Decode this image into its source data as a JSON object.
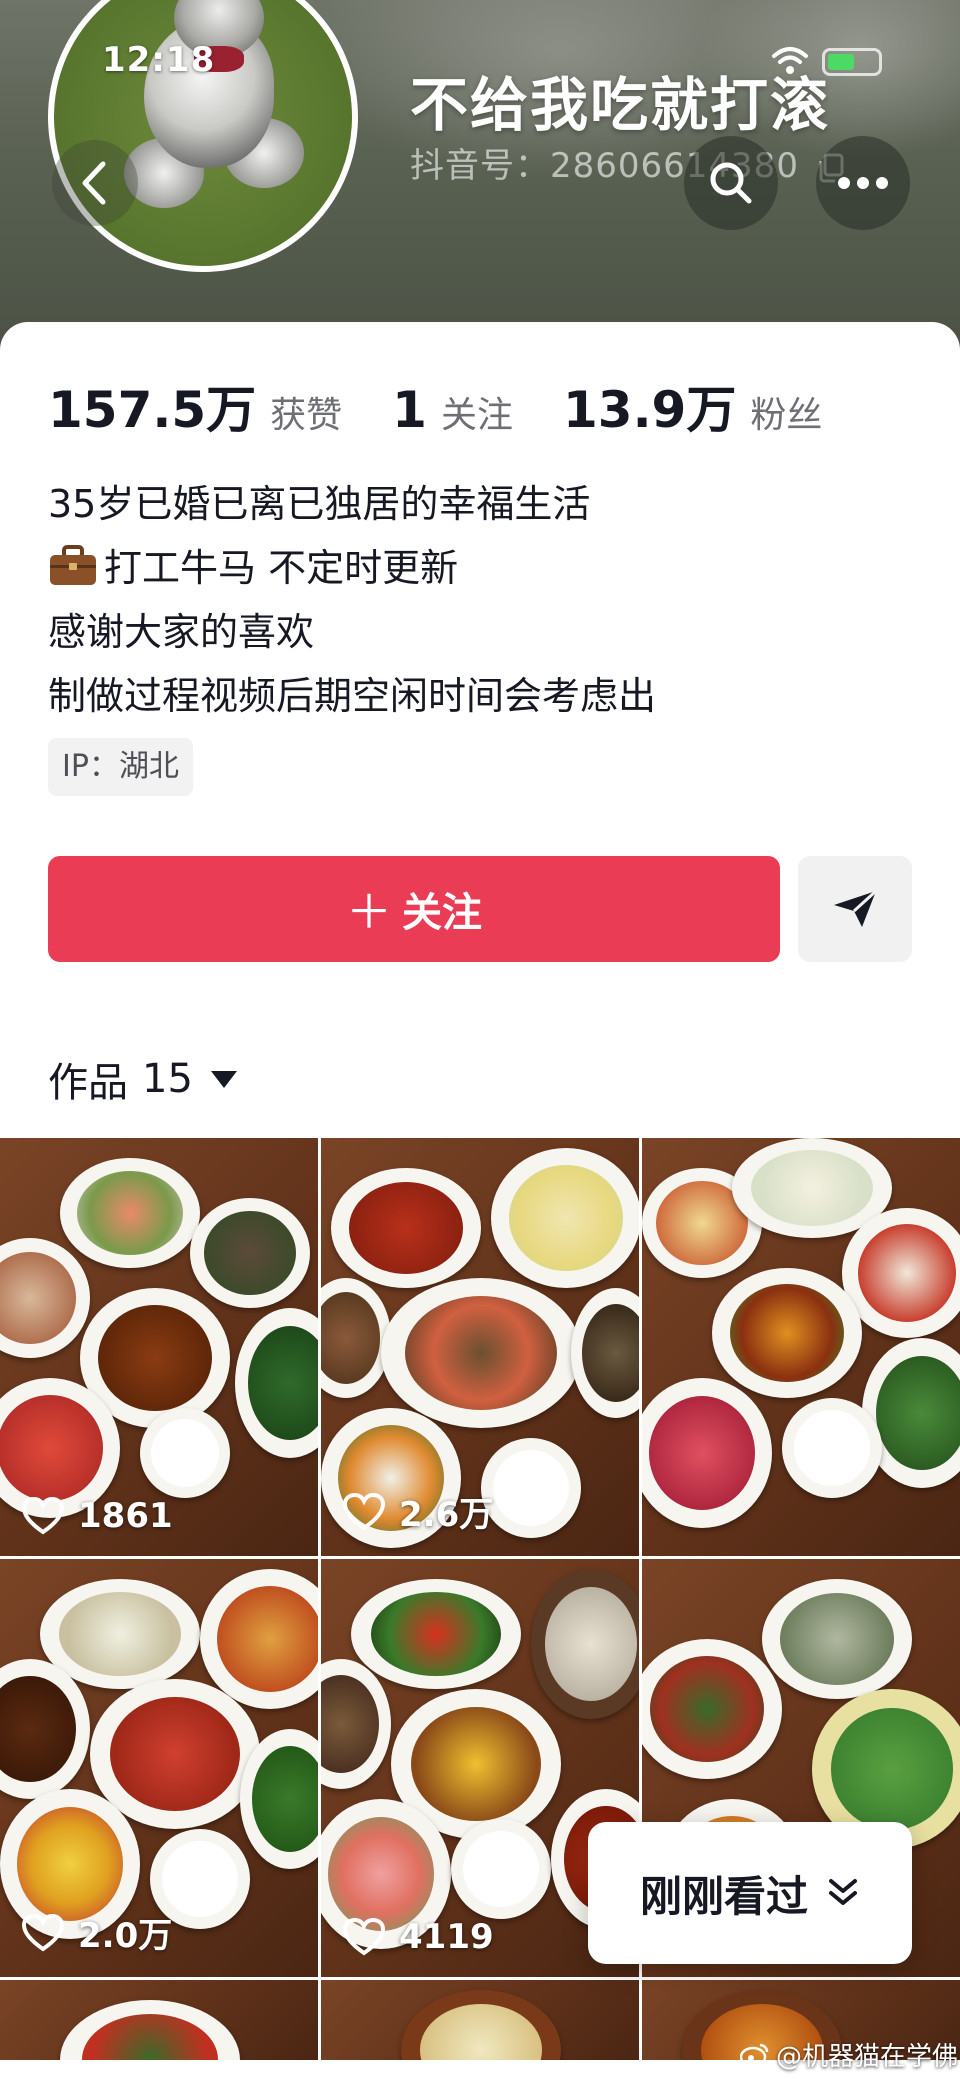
{
  "status_bar": {
    "time": "12:18"
  },
  "profile": {
    "username": "不给我吃就打滚",
    "douyin_id": "抖音号：28606614380",
    "stats": [
      {
        "value": "157.5万",
        "label": "获赞"
      },
      {
        "value": "1",
        "label": "关注"
      },
      {
        "value": "13.9万",
        "label": "粉丝"
      }
    ],
    "bio": [
      "35岁已婚已离已独居的幸福生活",
      "打工牛马 不定时更新",
      "感谢大家的喜欢",
      "制做过程视频后期空闲时间会考虑出"
    ],
    "ip": "IP：湖北"
  },
  "actions": {
    "follow_label": "关注"
  },
  "works": {
    "title": "作品",
    "count": "15",
    "tiles": [
      {
        "likes": "1861"
      },
      {
        "likes": "2.6万"
      },
      {
        "likes": ""
      },
      {
        "likes": "2.0万"
      },
      {
        "likes": "4119"
      },
      {
        "likes": ""
      }
    ]
  },
  "recent_button": {
    "label": "刚刚看过"
  },
  "watermark": "@机器猫在学佛",
  "icons": [
    "back-icon",
    "search-icon",
    "more-icon",
    "copy-icon",
    "briefcase-icon",
    "plus-icon",
    "send-icon",
    "caret-down-icon",
    "heart-icon",
    "double-chevron-down-icon",
    "wifi-icon",
    "battery-icon"
  ],
  "colors": {
    "accent": "#ea3d55",
    "text": "#161823",
    "muted": "#6e6f75"
  }
}
